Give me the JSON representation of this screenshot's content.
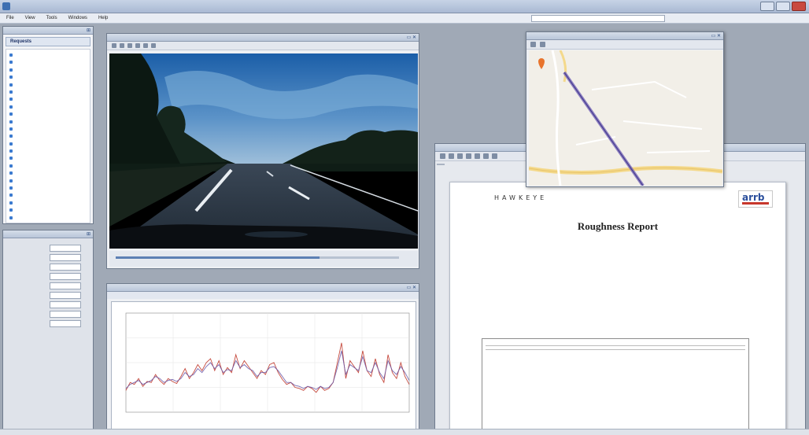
{
  "app": {
    "title": "",
    "url": ""
  },
  "menu": [
    "File",
    "View",
    "Tools",
    "Windows",
    "Help"
  ],
  "requests_panel": {
    "title": "",
    "header": "Requests",
    "items": [
      "",
      "",
      "",
      "",
      "",
      "",
      "",
      "",
      "",
      "",
      "",
      "",
      "",
      "",
      "",
      "",
      "",
      "",
      "",
      "",
      "",
      "",
      ""
    ]
  },
  "properties_panel": {
    "title": "",
    "rows": [
      {
        "label": "",
        "value": ""
      },
      {
        "label": "",
        "value": ""
      },
      {
        "label": "",
        "value": ""
      },
      {
        "label": "",
        "value": ""
      },
      {
        "label": "",
        "value": ""
      },
      {
        "label": "",
        "value": ""
      },
      {
        "label": "",
        "value": ""
      },
      {
        "label": "",
        "value": ""
      },
      {
        "label": "",
        "value": ""
      }
    ]
  },
  "video_window": {
    "title": "",
    "time": "",
    "progress": 0.72
  },
  "chart_window": {
    "title": "",
    "tabs": [
      "",
      "",
      ""
    ]
  },
  "chart_data": {
    "type": "line",
    "title": "",
    "xlabel": "",
    "ylabel": "",
    "series": [
      {
        "name": "",
        "color": "#c0392b",
        "values": [
          0.78,
          0.7,
          0.72,
          0.66,
          0.74,
          0.69,
          0.7,
          0.62,
          0.68,
          0.72,
          0.66,
          0.69,
          0.71,
          0.64,
          0.56,
          0.66,
          0.6,
          0.52,
          0.58,
          0.5,
          0.46,
          0.58,
          0.48,
          0.62,
          0.55,
          0.6,
          0.42,
          0.56,
          0.48,
          0.54,
          0.6,
          0.66,
          0.58,
          0.62,
          0.52,
          0.5,
          0.6,
          0.67,
          0.72,
          0.7,
          0.75,
          0.76,
          0.78,
          0.74,
          0.76,
          0.8,
          0.74,
          0.78,
          0.76,
          0.7,
          0.5,
          0.3,
          0.66,
          0.48,
          0.54,
          0.6,
          0.38,
          0.58,
          0.64,
          0.46,
          0.62,
          0.7,
          0.42,
          0.6,
          0.66,
          0.5,
          0.64,
          0.72
        ]
      },
      {
        "name": "",
        "color": "#6c5aa8",
        "values": [
          0.76,
          0.72,
          0.7,
          0.68,
          0.72,
          0.7,
          0.68,
          0.64,
          0.66,
          0.7,
          0.68,
          0.67,
          0.69,
          0.66,
          0.6,
          0.64,
          0.62,
          0.56,
          0.6,
          0.54,
          0.5,
          0.56,
          0.52,
          0.6,
          0.57,
          0.58,
          0.48,
          0.55,
          0.52,
          0.56,
          0.58,
          0.64,
          0.6,
          0.6,
          0.55,
          0.54,
          0.58,
          0.64,
          0.7,
          0.7,
          0.73,
          0.74,
          0.76,
          0.74,
          0.75,
          0.77,
          0.74,
          0.76,
          0.75,
          0.7,
          0.55,
          0.38,
          0.62,
          0.52,
          0.55,
          0.58,
          0.44,
          0.58,
          0.6,
          0.5,
          0.6,
          0.66,
          0.48,
          0.58,
          0.62,
          0.54,
          0.6,
          0.68
        ]
      }
    ]
  },
  "report_window": {
    "title": "",
    "tab": ""
  },
  "report": {
    "logo_text": "HAWKEYE",
    "brand_logo": "arrb",
    "title": "Roughness Report",
    "fields": [
      {
        "key": "",
        "value": ""
      },
      {
        "key": "",
        "value": ""
      },
      {
        "key": "",
        "value": ""
      },
      {
        "key": "",
        "value": ""
      },
      {
        "key": "",
        "value": ""
      },
      {
        "key": "",
        "value": ""
      },
      {
        "key": "",
        "value": ""
      },
      {
        "key": "",
        "value": ""
      },
      {
        "key": "",
        "value": ""
      },
      {
        "key": "",
        "value": ""
      },
      {
        "key": "",
        "value": ""
      },
      {
        "key": "",
        "value": ""
      },
      {
        "key": "",
        "value": ""
      },
      {
        "key": "",
        "value": ""
      }
    ],
    "box_sections": [
      {
        "title": "",
        "lines": [
          ""
        ]
      },
      {
        "title": "",
        "lines": [
          "",
          ""
        ]
      },
      {
        "title": "",
        "lines": [
          "",
          ""
        ]
      }
    ]
  },
  "map_window": {
    "title": "",
    "toolbar_items": [
      "",
      "",
      ""
    ],
    "label": "",
    "footer": ""
  },
  "status": {
    "text": ""
  }
}
